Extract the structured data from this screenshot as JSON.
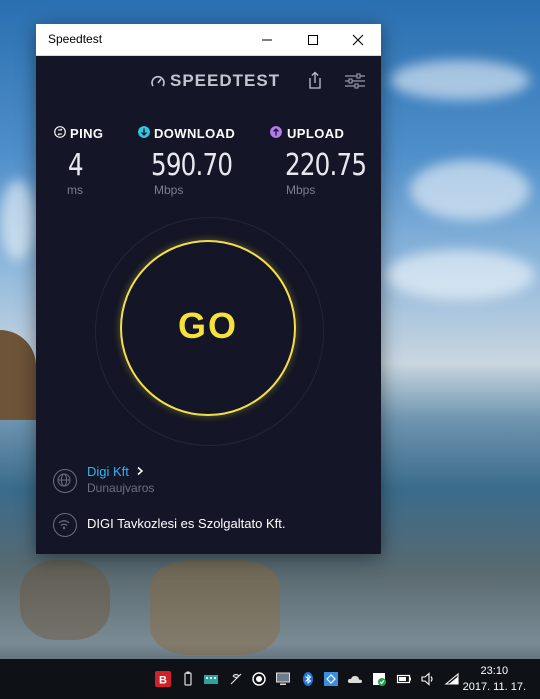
{
  "window": {
    "title": "Speedtest"
  },
  "app": {
    "brand": "SPEEDTEST",
    "metrics": [
      {
        "label": "PING",
        "value": "4",
        "unit": "ms",
        "icon": "ping-icon",
        "color": "#ffffff"
      },
      {
        "label": "DOWNLOAD",
        "value": "590.70",
        "unit": "Mbps",
        "icon": "download-icon",
        "color": "#35c6dd"
      },
      {
        "label": "UPLOAD",
        "value": "220.75",
        "unit": "Mbps",
        "icon": "upload-icon",
        "color": "#b57cf2"
      }
    ],
    "go_label": "GO",
    "server": {
      "name": "Digi Kft",
      "location": "Dunaujvaros"
    },
    "isp": {
      "name": "DIGI Tavkozlesi es Szolgaltato Kft."
    },
    "accent": "#f7e23b"
  },
  "taskbar": {
    "time": "23:10",
    "date": "2017. 11. 17."
  }
}
